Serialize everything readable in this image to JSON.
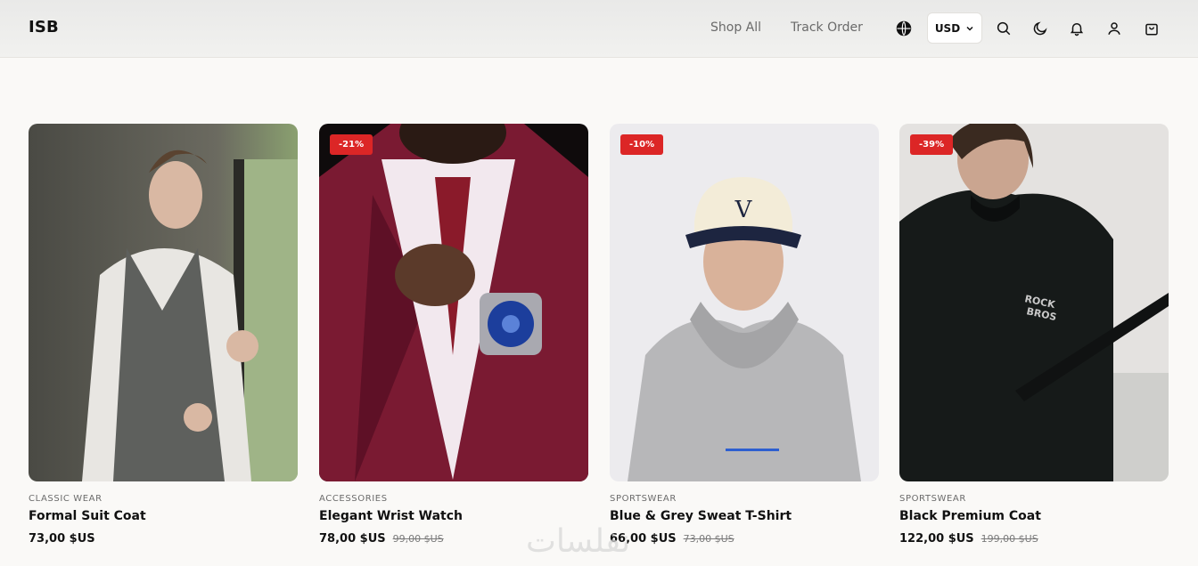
{
  "header": {
    "logo": "ISB",
    "nav": [
      "Shop All",
      "Track Order"
    ],
    "currency": "USD",
    "icons": [
      "globe-icon",
      "search-icon",
      "moon-icon",
      "bell-icon",
      "user-icon",
      "cart-icon"
    ]
  },
  "products": [
    {
      "badge": "",
      "category": "CLASSIC WEAR",
      "name": "Formal Suit Coat",
      "price": "73,00 $US",
      "old_price": ""
    },
    {
      "badge": "-21%",
      "category": "ACCESSORIES",
      "name": "Elegant Wrist Watch",
      "price": "78,00 $US",
      "old_price": "99,00 $US"
    },
    {
      "badge": "-10%",
      "category": "SPORTSWEAR",
      "name": "Blue & Grey Sweat T-Shirt",
      "price": "66,00 $US",
      "old_price": "73,00 $US"
    },
    {
      "badge": "-39%",
      "category": "SPORTSWEAR",
      "name": "Black Premium Coat",
      "price": "122,00 $US",
      "old_price": "199,00 $US"
    }
  ],
  "watermark": "نفلسات"
}
